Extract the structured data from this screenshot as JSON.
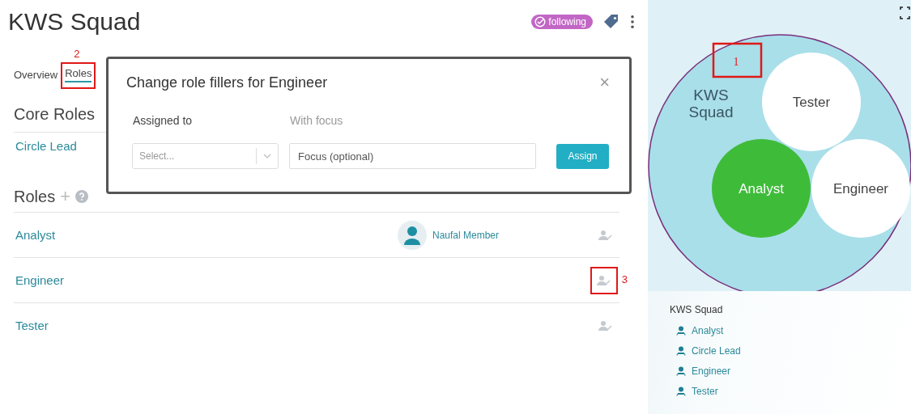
{
  "header": {
    "title": "KWS Squad",
    "follow_badge": {
      "label": "following",
      "following": true
    }
  },
  "tabs": [
    {
      "label": "Overview",
      "selected": false
    },
    {
      "label": "Roles",
      "selected": true,
      "annotation": "2"
    }
  ],
  "core_roles": {
    "heading": "Core Roles",
    "roles": [
      {
        "name": "Circle Lead"
      }
    ]
  },
  "roles": {
    "heading": "Roles",
    "add_symbol": "+",
    "items": [
      {
        "name": "Analyst",
        "filler": "Naufal Member"
      },
      {
        "name": "Engineer",
        "annotation": "3"
      },
      {
        "name": "Tester"
      }
    ]
  },
  "modal": {
    "title": "Change role fillers for Engineer",
    "close": "×",
    "assigned_label": "Assigned to",
    "focus_label": "With focus",
    "select": {
      "placeholder": "Select..."
    },
    "focus_field": {
      "placeholder": "Focus (optional)"
    },
    "assign_button": "Assign"
  },
  "circle_map": {
    "circle": [
      "KWS",
      "Squad"
    ],
    "annotation": "1",
    "roles": [
      {
        "name": "Tester",
        "selected": false
      },
      {
        "name": "Analyst",
        "selected": true
      },
      {
        "name": "Engineer",
        "selected": false
      }
    ]
  },
  "role_tree": {
    "circle": "KWS Squad",
    "items": [
      "Analyst",
      "Circle Lead",
      "Engineer",
      "Tester"
    ]
  }
}
